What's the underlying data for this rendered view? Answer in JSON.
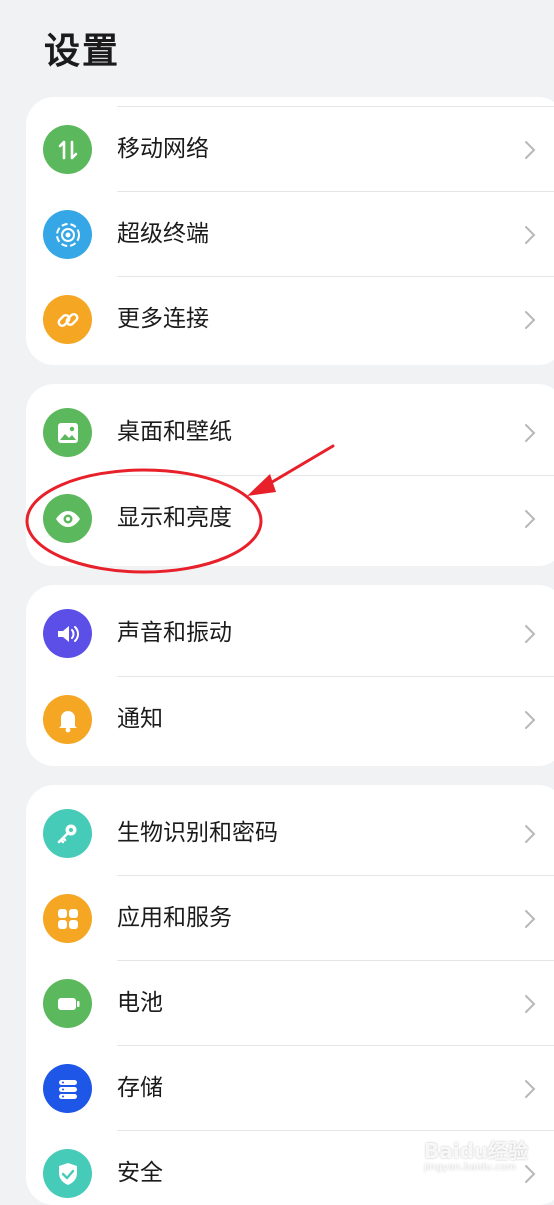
{
  "header": {
    "title": "设置"
  },
  "groups": [
    {
      "items": [
        {
          "label": "移动网络",
          "icon": "mobile-network-icon",
          "color": "#5cb85c"
        },
        {
          "label": "超级终端",
          "icon": "super-device-icon",
          "color": "#36a7e6"
        },
        {
          "label": "更多连接",
          "icon": "link-icon",
          "color": "#f5a623"
        }
      ]
    },
    {
      "items": [
        {
          "label": "桌面和壁纸",
          "icon": "wallpaper-icon",
          "color": "#5cb85c"
        },
        {
          "label": "显示和亮度",
          "icon": "eye-icon",
          "color": "#5cb85c"
        }
      ]
    },
    {
      "items": [
        {
          "label": "声音和振动",
          "icon": "speaker-icon",
          "color": "#5b4fe8"
        },
        {
          "label": "通知",
          "icon": "bell-icon",
          "color": "#f5a623"
        }
      ]
    },
    {
      "items": [
        {
          "label": "生物识别和密码",
          "icon": "key-icon",
          "color": "#46cbb8"
        },
        {
          "label": "应用和服务",
          "icon": "apps-icon",
          "color": "#f5a623"
        },
        {
          "label": "电池",
          "icon": "battery-icon",
          "color": "#5cb85c"
        },
        {
          "label": "存储",
          "icon": "storage-icon",
          "color": "#1e56e8"
        },
        {
          "label": "安全",
          "icon": "shield-icon",
          "color": "#46cbb8"
        }
      ]
    }
  ],
  "annotation": {
    "highlight_color": "#e8202a"
  },
  "watermark": {
    "brand": "Baidu经验",
    "url": "jingyan.baidu.com"
  }
}
